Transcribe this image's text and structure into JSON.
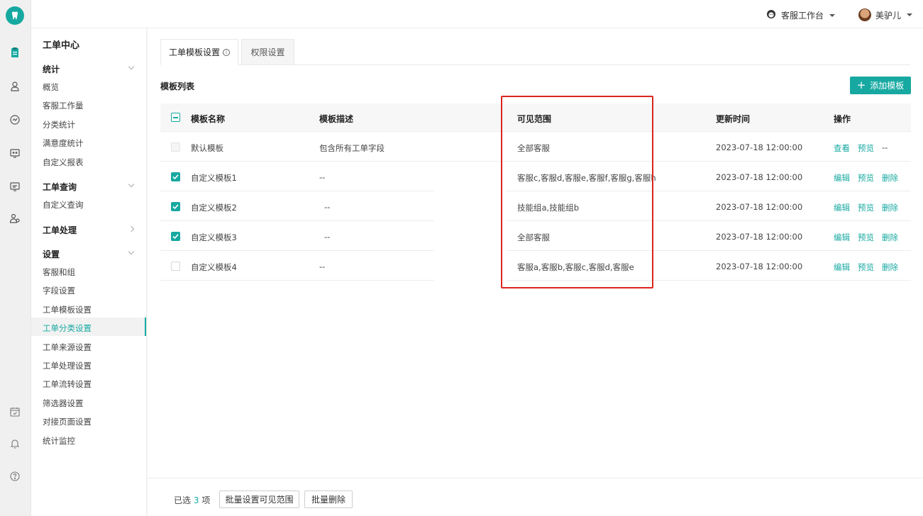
{
  "colors": {
    "accent": "#17a9a1",
    "highlight": "#d9261c"
  },
  "topbar": {
    "workspace_label": "客服工作台",
    "workspace_icon": "headset-agent-icon",
    "user_name": "美驴儿"
  },
  "rail": {
    "icons": [
      "app-logo-icon",
      "clipboard-icon",
      "agent-icon",
      "dashboard-gauge-icon",
      "chat-monitor-icon",
      "screen-chat-icon",
      "user-group-icon",
      "calendar-check-icon",
      "bell-icon",
      "help-icon"
    ]
  },
  "sidebar": {
    "title": "工单中心",
    "groups": {
      "stats": {
        "label": "统计",
        "items": [
          "概览",
          "客服工作量",
          "分类统计",
          "满意度统计",
          "自定义报表"
        ]
      },
      "query": {
        "label": "工单查询",
        "items": [
          "自定义查询"
        ]
      },
      "process": {
        "label": "工单处理"
      },
      "settings": {
        "label": "设置",
        "items": [
          "客服和组",
          "字段设置",
          "工单模板设置",
          "工单分类设置",
          "工单来源设置",
          "工单处理设置",
          "工单流转设置",
          "筛选器设置",
          "对接页面设置",
          "统计监控"
        ],
        "active_item": "工单分类设置"
      }
    }
  },
  "tabs": [
    {
      "label": "工单模板设置",
      "active": true,
      "has_info": true
    },
    {
      "label": "权限设置",
      "active": false
    }
  ],
  "section_title": "模板列表",
  "add_button_label": "添加模板",
  "table": {
    "columns": [
      "模板名称",
      "模板描述",
      "可见范围",
      "更新时间",
      "操作"
    ],
    "rows": [
      {
        "name": "默认模板",
        "desc": "包含所有工单字段",
        "scope": "全部客服",
        "updated": "2023-07-18 12:00:00",
        "actions": [
          "查看",
          "预览",
          "--"
        ],
        "checked": false,
        "disabled": true
      },
      {
        "name": "自定义模板1",
        "desc": "--",
        "scope": "客服c,客服d,客服e,客服f,客服g,客服h",
        "updated": "2023-07-18 12:00:00",
        "actions": [
          "编辑",
          "预览",
          "删除"
        ],
        "checked": true
      },
      {
        "name": "自定义模板2",
        "desc": "--",
        "scope": "技能组a,技能组b",
        "updated": "2023-07-18 12:00:00",
        "actions": [
          "编辑",
          "预览",
          "删除"
        ],
        "checked": true
      },
      {
        "name": "自定义模板3",
        "desc": "--",
        "scope": "全部客服",
        "updated": "2023-07-18 12:00:00",
        "actions": [
          "编辑",
          "预览",
          "删除"
        ],
        "checked": true
      },
      {
        "name": "自定义模板4",
        "desc": "--",
        "scope": "客服a,客服b,客服c,客服d,客服e",
        "updated": "2023-07-18 12:00:00",
        "actions": [
          "编辑",
          "预览",
          "删除"
        ],
        "checked": false
      }
    ]
  },
  "footer": {
    "selected_prefix": "已选",
    "selected_count": "3",
    "selected_suffix": "项",
    "batch_scope_label": "批量设置可见范围",
    "batch_delete_label": "批量删除"
  }
}
